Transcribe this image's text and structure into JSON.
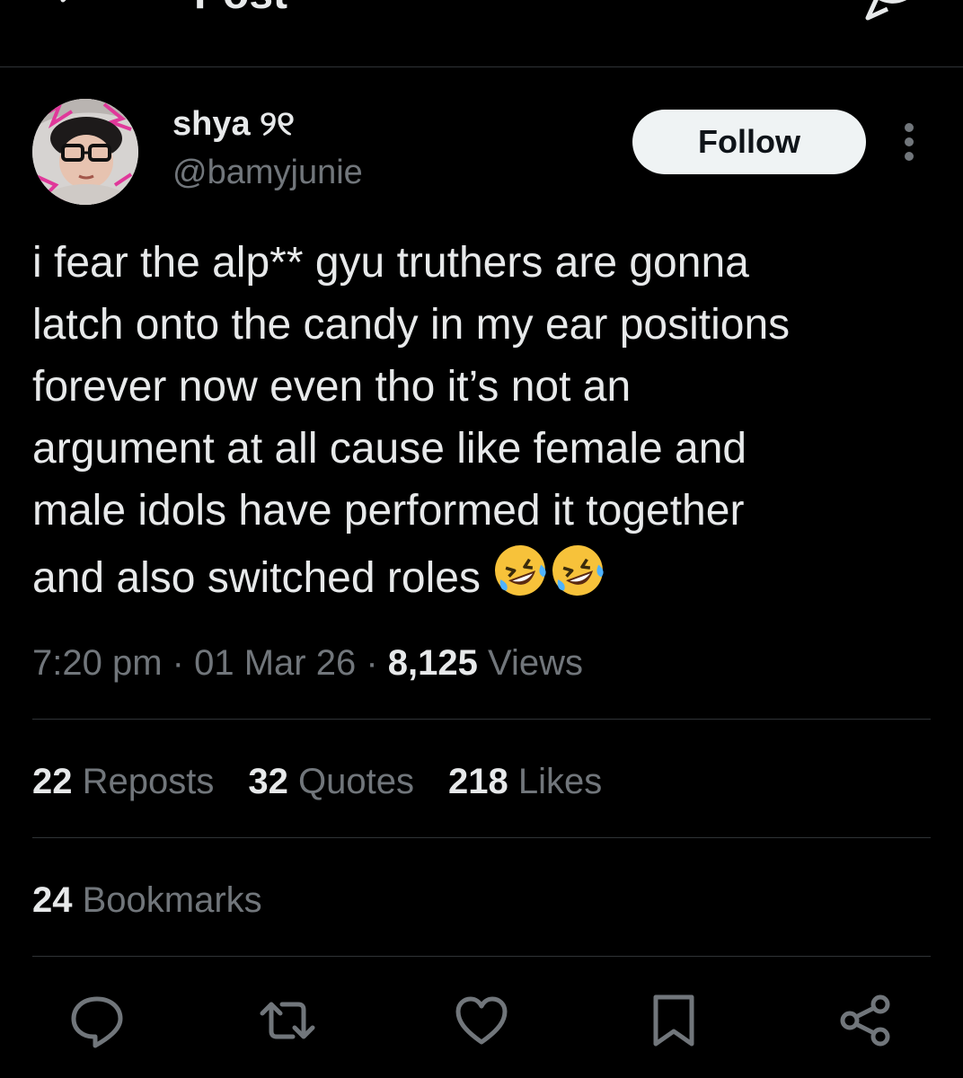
{
  "header": {
    "title": "Post",
    "back_icon": "arrow-left-icon",
    "top_right_icon": "reply-icon"
  },
  "author": {
    "display_name": "shya ୨୧",
    "handle": "@bamyjunie",
    "avatar_icon": "profile-photo"
  },
  "actions_top": {
    "follow_label": "Follow",
    "more_icon": "more-vertical-icon"
  },
  "tweet": {
    "text": "i fear the alp** gyu truthers are gonna\nlatch onto the candy in my ear positions\nforever now even tho it’s not an\nargument at all cause like female and\nmale idols have performed it together\nand also switched roles",
    "emoji_icon": "rolling-on-floor-laughing-emoji",
    "emoji_count": 2
  },
  "meta": {
    "time": "7:20 pm",
    "separator": "·",
    "date": "01 Mar 26",
    "views_count": "8,125",
    "views_label": "Views"
  },
  "stats": [
    {
      "count": "22",
      "label": "Reposts"
    },
    {
      "count": "32",
      "label": "Quotes"
    },
    {
      "count": "218",
      "label": "Likes"
    }
  ],
  "bookmarks": {
    "count": "24",
    "label": "Bookmarks"
  },
  "action_bar": [
    {
      "name": "reply-icon"
    },
    {
      "name": "repost-icon"
    },
    {
      "name": "like-icon"
    },
    {
      "name": "bookmark-icon"
    },
    {
      "name": "share-icon"
    }
  ],
  "colors": {
    "background": "#000000",
    "text_primary": "#e7e9ea",
    "text_secondary": "#71767b",
    "divider": "#2f3336",
    "follow_bg": "#eff3f4",
    "follow_text": "#0f1419"
  }
}
